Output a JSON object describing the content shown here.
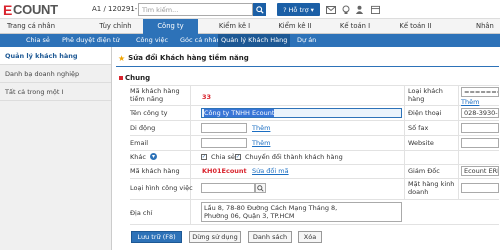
{
  "topbar": {
    "logo_text": "COUNT",
    "logo_letter": "E",
    "account": "A1 / 120291-100",
    "search_placeholder": "Tìm kiếm...",
    "help_label": "Hỗ trợ"
  },
  "main_menu": [
    {
      "label": "Trang cá nhân"
    },
    {
      "label": "Tùy chỉnh"
    },
    {
      "label": "Công ty"
    },
    {
      "label": "Kiểm kê I"
    },
    {
      "label": "Kiểm kê II"
    },
    {
      "label": "Kế toán I"
    },
    {
      "label": "Kế toán II"
    },
    {
      "label": "Nhân"
    }
  ],
  "sub_menu": [
    {
      "label": "Chia sẻ"
    },
    {
      "label": "Phê duyệt điện tử"
    },
    {
      "label": "Công việc"
    },
    {
      "label": "Góc cá nhân"
    },
    {
      "label": "Quản lý Khách Hàng"
    },
    {
      "label": "Dự án"
    }
  ],
  "sidebar": {
    "items": [
      {
        "label": "Quản lý khách hàng"
      },
      {
        "label": "Danh bạ doanh nghiệp"
      },
      {
        "label": "Tất cả trong một I"
      }
    ]
  },
  "page": {
    "title": "Sửa đổi Khách hàng tiềm năng",
    "section": "Chung"
  },
  "form": {
    "code_label": "Mã khách hàng tiềm năng",
    "code_value": "33",
    "company_label": "Tên công ty",
    "company_value": "Công ty TNHH Ecount",
    "mobile_label": "Di động",
    "add_link": "Thêm",
    "email_label": "Email",
    "other_label": "Khác",
    "share_label": "Chia sẻ",
    "convert_label": "Chuyển đổi thành khách hàng",
    "customer_code_label": "Mã khách hàng",
    "customer_code_value": "KH01Ecount",
    "edit_code_link": "Sửa đổi mã",
    "business_type_label": "Loại hình công việc",
    "address_label": "Địa chỉ",
    "address_line1": "Lầu 8, 78-80 Đường Cách Mạng Tháng 8,",
    "address_line2": "Phường 06, Quận 3, TP.HCM",
    "type_label": "Loại khách hàng",
    "type_value": "==========",
    "phone_label": "Điện thoại",
    "phone_value": "028-3930-0",
    "fax_label": "Số fax",
    "website_label": "Website",
    "director_label": "Giám Đốc",
    "director_value": "Ecount ERP",
    "products_label": "Mặt hàng kinh doanh"
  },
  "buttons": {
    "save": "Lưu trữ (F8)",
    "stop": "Dừng sử dụng",
    "list": "Danh sách",
    "delete": "Xóa"
  }
}
